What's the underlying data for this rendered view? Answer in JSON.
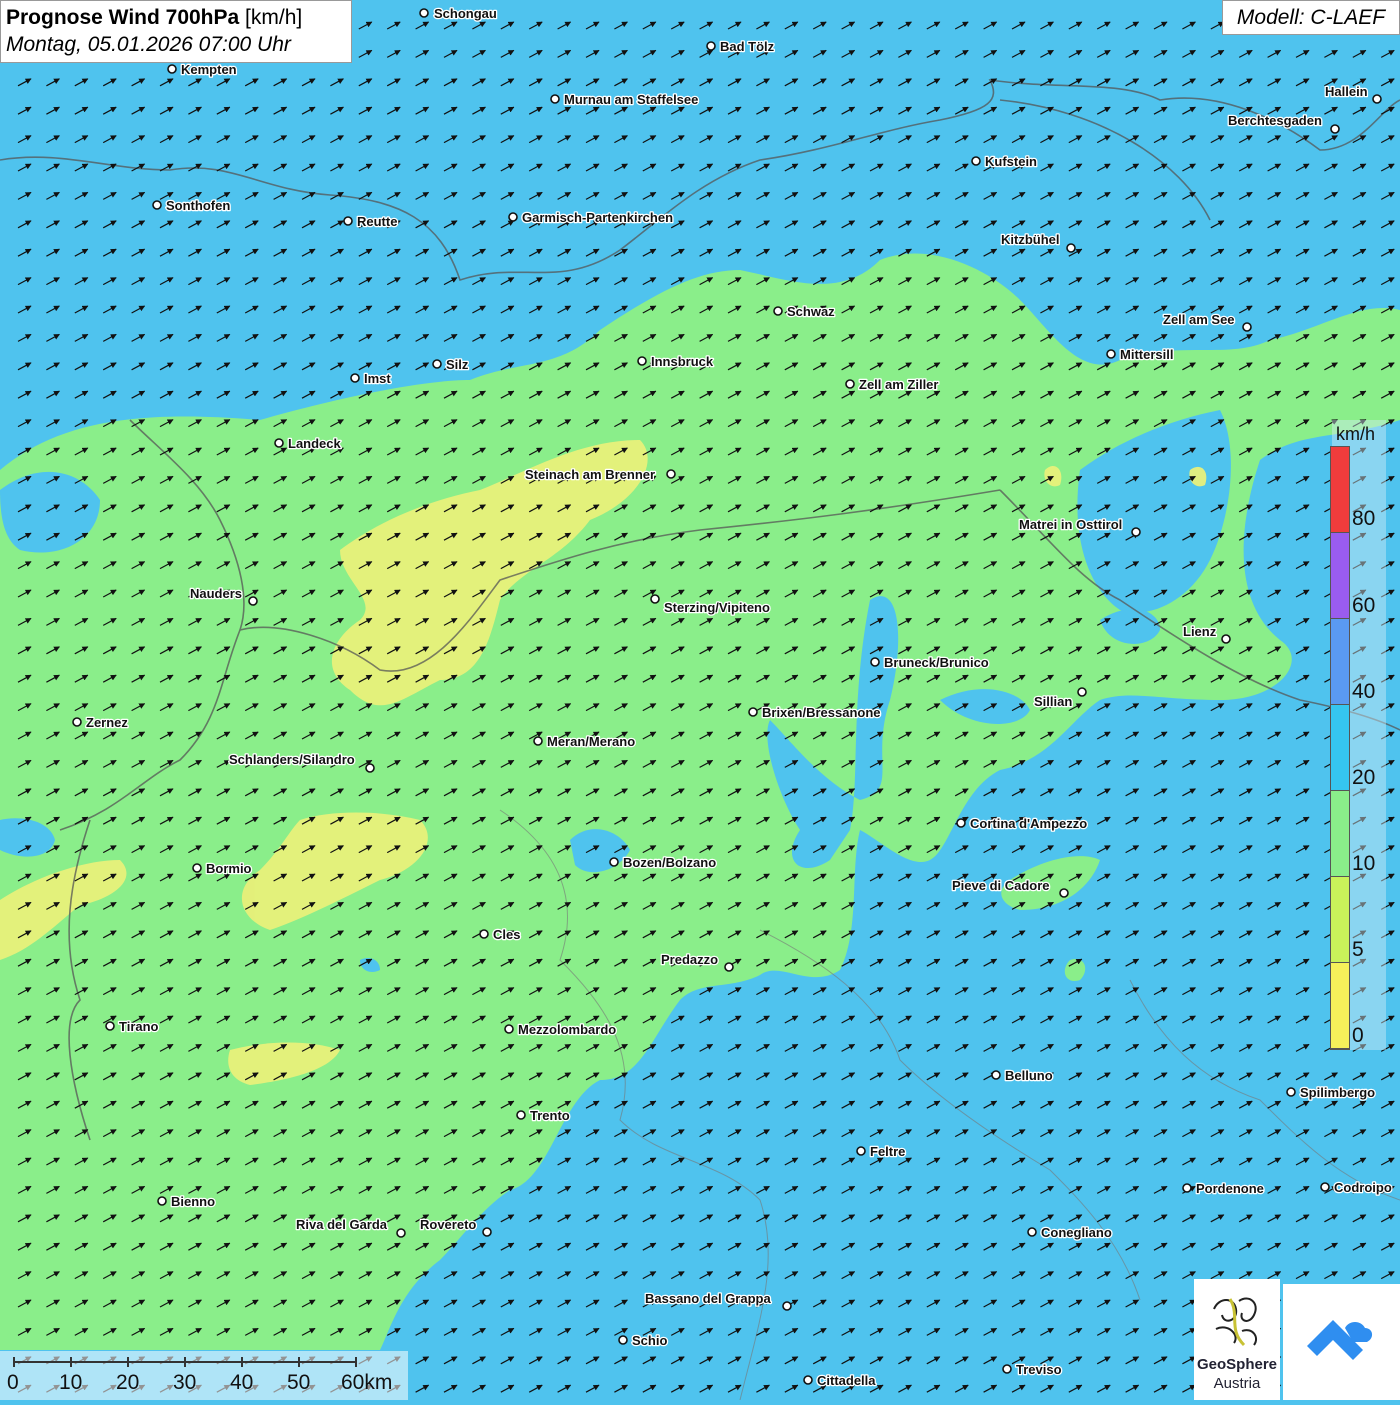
{
  "title": {
    "main": "Prognose Wind 700hPa",
    "unit": "[km/h]",
    "datetime": "Montag, 05.01.2026 07:00 Uhr"
  },
  "model": "Modell: C-LAEF",
  "legend": {
    "unit": "km/h",
    "labels": [
      "80",
      "60",
      "40",
      "20",
      "10",
      "5",
      "0"
    ],
    "colors": [
      "#f03c3c",
      "#9a5cf0",
      "#5a9af2",
      "#35c6f0",
      "#8aee8a",
      "#c9f25a",
      "#f6f05a"
    ]
  },
  "scalebar": {
    "labels": [
      "0",
      "10",
      "20",
      "30",
      "40",
      "50",
      "60km"
    ]
  },
  "logo": {
    "name": "GeoSphere",
    "sub": "Austria"
  },
  "colors": {
    "low_wind_blue": "#4fc3ee",
    "mid_wind_green": "#8aee8a",
    "calm_yellow": "#e8f07a",
    "arrow": "#111111"
  },
  "cities": [
    "Schongau",
    "Bad Tölz",
    "Kempten",
    "Murnau am Staffelsee",
    "Hallein",
    "Berchtesgaden",
    "Kufstein",
    "Sonthofen",
    "Reutte",
    "Garmisch-Partenkirchen",
    "Kitzbühel",
    "Schwaz",
    "Zell am See",
    "Mittersill",
    "Innsbruck",
    "Silz",
    "Imst",
    "Zell am Ziller",
    "Landeck",
    "Steinach am Brenner",
    "Matrei in Osttirol",
    "Nauders",
    "Sterzing/Vipiteno",
    "Lienz",
    "Bruneck/Brunico",
    "Sillian",
    "Brixen/Bressanone",
    "Zernez",
    "Meran/Merano",
    "Schlanders/Silandro",
    "Cortina d'Ampezzo",
    "Bozen/Bolzano",
    "Bormio",
    "Pieve di Cadore",
    "Cles",
    "Predazzo",
    "Tirano",
    "Mezzolombardo",
    "Belluno",
    "Spilimbergo",
    "Trento",
    "Feltre",
    "Pordenone",
    "Codroipo",
    "Bienno",
    "Riva del Garda",
    "Rovereto",
    "Conegliano",
    "Bassano del Grappa",
    "Schio",
    "Treviso",
    "Cittadella"
  ]
}
